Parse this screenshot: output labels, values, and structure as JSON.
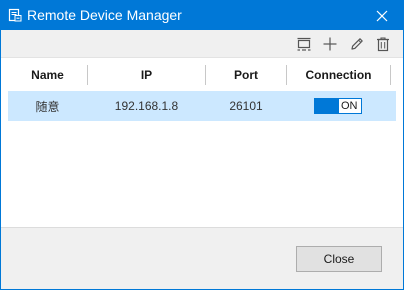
{
  "window": {
    "title": "Remote Device Manager",
    "accent_color": "#0078d7",
    "title_icon": "device-manager-app-icon",
    "close_icon": "close-icon"
  },
  "toolbar": {
    "buttons": [
      {
        "name": "layout",
        "icon": "layout-icon"
      },
      {
        "name": "add",
        "icon": "plus-icon"
      },
      {
        "name": "edit",
        "icon": "pencil-icon"
      },
      {
        "name": "delete",
        "icon": "trash-icon"
      }
    ]
  },
  "table": {
    "columns": [
      "Name",
      "IP",
      "Port",
      "Connection"
    ],
    "rows": [
      {
        "name": "随意",
        "ip": "192.168.1.8",
        "port": "26101",
        "connection": "ON",
        "selected": true
      }
    ],
    "selected_row_color": "#cce8ff"
  },
  "footer": {
    "close_label": "Close"
  }
}
